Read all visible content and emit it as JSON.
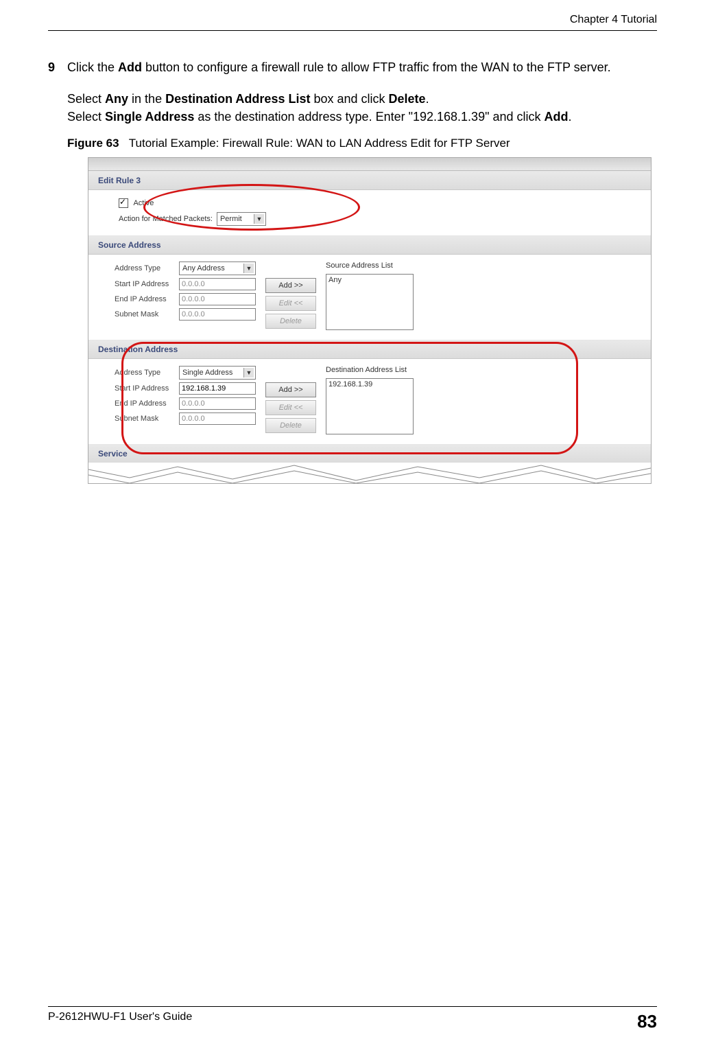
{
  "header": {
    "chapter": "Chapter 4 Tutorial"
  },
  "step": {
    "number": "9",
    "text_prefix": "Click the ",
    "btn1": "Add",
    "text_suffix": " button to configure a firewall rule to allow FTP traffic from the WAN to the FTP server."
  },
  "para": {
    "p1_a": "Select ",
    "p1_b": "Any",
    "p1_c": " in the ",
    "p1_d": "Destination Address List",
    "p1_e": " box and click ",
    "p1_f": "Delete",
    "p1_g": ".",
    "p2_a": "Select ",
    "p2_b": "Single Address",
    "p2_c": " as the destination address type. Enter \"192.168.1.39\" and click ",
    "p2_d": "Add",
    "p2_e": "."
  },
  "figure": {
    "label": "Figure 63",
    "caption": "Tutorial Example: Firewall Rule: WAN to LAN Address Edit for FTP Server"
  },
  "ui": {
    "edit_rule": "Edit Rule 3",
    "active": "Active",
    "action_label": "Action for Matched Packets:",
    "action_value": "Permit",
    "source_hdr": "Source Address",
    "dest_hdr": "Destination Address",
    "service_hdr": "Service",
    "addr_type": "Address Type",
    "start_ip": "Start IP Address",
    "end_ip": "End IP Address",
    "subnet": "Subnet Mask",
    "any_address": "Any Address",
    "single_address": "Single Address",
    "zero_ip": "0.0.0.0",
    "src_start_ip": "0.0.0.0",
    "dest_start_ip": "192.168.1.39",
    "btn_add": "Add >>",
    "btn_edit": "Edit <<",
    "btn_delete": "Delete",
    "src_list_title": "Source Address List",
    "dest_list_title": "Destination Address List",
    "src_list_item": "Any",
    "dest_list_item": "192.168.1.39"
  },
  "footer": {
    "guide": "P-2612HWU-F1 User's Guide",
    "page": "83"
  }
}
